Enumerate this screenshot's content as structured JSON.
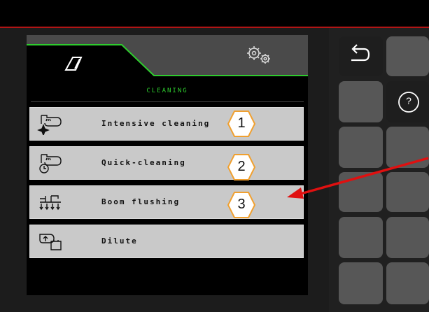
{
  "screen": {
    "title": "CLEANING",
    "tabs": [
      {
        "icon": "machine-tab-icon"
      },
      {
        "icon": "settings-gears-icon"
      }
    ]
  },
  "menu": [
    {
      "label": "Intensive cleaning",
      "icon": "intensive-cleaning-icon",
      "callout": "1"
    },
    {
      "label": "Quick-cleaning",
      "icon": "quick-cleaning-icon",
      "callout": "2"
    },
    {
      "label": "Boom flushing",
      "icon": "boom-flushing-icon",
      "callout": "3"
    },
    {
      "label": "Dilute",
      "icon": "dilute-icon",
      "callout": ""
    }
  ],
  "side_panel": {
    "back_icon": "back-arrow-icon",
    "help_icon": "help-icon",
    "help_glyph": "?"
  },
  "colors": {
    "accent_green": "#2ecc2e",
    "callout_orange": "#f0a030",
    "annotation_red": "#e01010",
    "menu_gray": "#c9c9c9"
  }
}
